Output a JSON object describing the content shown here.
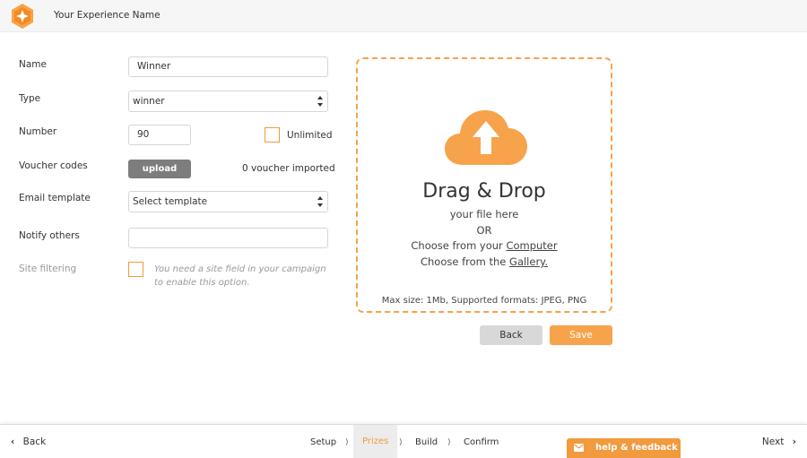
{
  "header": {
    "title": "Your Experience Name",
    "logo_icon": "logo-icon",
    "brand_color": "#f7a34b"
  },
  "form": {
    "name": {
      "label": "Name",
      "value": "Winner"
    },
    "type": {
      "label": "Type",
      "value": "winner"
    },
    "number": {
      "label": "Number",
      "value": "90",
      "unlimited_label": "Unlimited"
    },
    "voucher": {
      "label": "Voucher codes",
      "button": "upload",
      "status": "0 voucher imported"
    },
    "email_template": {
      "label": "Email template",
      "value": "Select template"
    },
    "notify": {
      "label": "Notify others",
      "value": ""
    },
    "site_filtering": {
      "label": "Site filtering",
      "hint": "You need a site field in your campaign to enable this option."
    }
  },
  "dropzone": {
    "title": "Drag & Drop",
    "line1": "your file here",
    "line2": "OR",
    "computer_prefix": "Choose from your ",
    "computer_link": "Computer",
    "gallery_prefix": "Choose from the ",
    "gallery_link": "Gallery.",
    "max": "Max size: 1Mb, Supported formats: JPEG, PNG"
  },
  "actions": {
    "back": "Back",
    "save": "Save"
  },
  "footer": {
    "back": "Back",
    "next": "Next",
    "steps": [
      "Setup",
      "Prizes",
      "Build",
      "Confirm"
    ],
    "active_step": "Prizes",
    "help": "help & feedback"
  }
}
